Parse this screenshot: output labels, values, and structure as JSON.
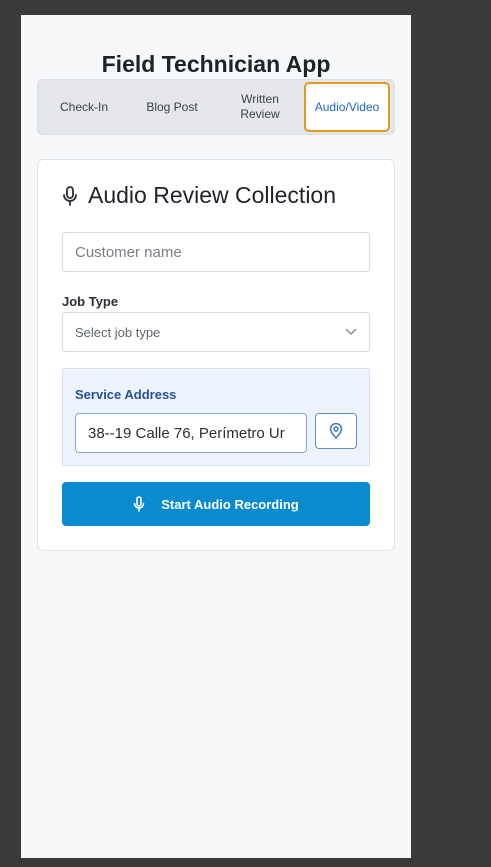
{
  "app": {
    "title": "Field Technician App"
  },
  "tabs": [
    {
      "label": "Check-In"
    },
    {
      "label": "Blog Post"
    },
    {
      "label": "Written Review"
    },
    {
      "label": "Audio/Video",
      "active": true
    }
  ],
  "card": {
    "icon": "microphone-icon",
    "title": "Audio Review Collection"
  },
  "customer": {
    "placeholder": "Customer name",
    "value": ""
  },
  "job_type": {
    "label": "Job Type",
    "selected": "Select job type",
    "icon": "chevron-down-icon"
  },
  "address": {
    "label": "Service Address",
    "value": "38--19 Calle 76, Perímetro Ur",
    "locate_icon": "map-pin-icon"
  },
  "record": {
    "label": "Start Audio Recording",
    "icon": "microphone-icon"
  },
  "colors": {
    "accent": "#0b8bcf",
    "active_tab_border": "#e09a1f",
    "active_tab_text": "#2563c9",
    "address_bg": "#eef4fd"
  }
}
